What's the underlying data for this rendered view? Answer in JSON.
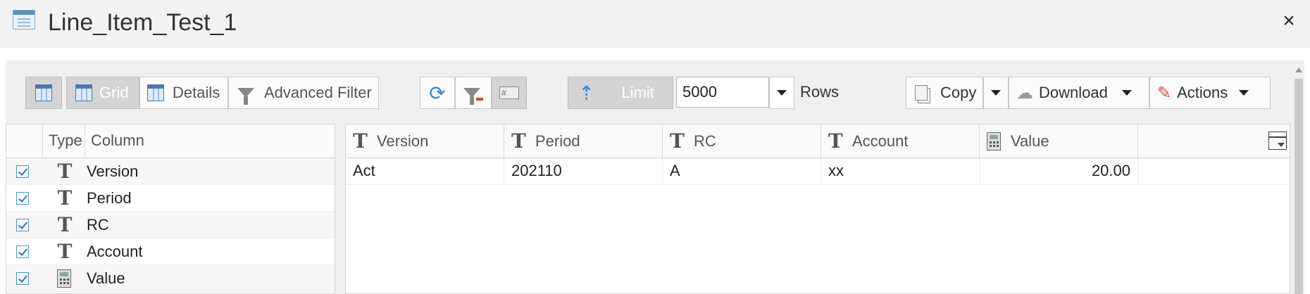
{
  "window": {
    "title": "Line_Item_Test_1",
    "close_label": "×"
  },
  "toolbar": {
    "grid_label": "Grid",
    "details_label": "Details",
    "advanced_filter_label": "Advanced Filter",
    "limit_label": "Limit",
    "limit_value": "5000",
    "rows_label": "Rows",
    "copy_label": "Copy",
    "download_label": "Download",
    "actions_label": "Actions",
    "hash_label": "#"
  },
  "column_list": {
    "headers": {
      "type": "Type",
      "column": "Column"
    },
    "rows": [
      {
        "name": "Version",
        "type": "text",
        "checked": true
      },
      {
        "name": "Period",
        "type": "text",
        "checked": true
      },
      {
        "name": "RC",
        "type": "text",
        "checked": true
      },
      {
        "name": "Account",
        "type": "text",
        "checked": true
      },
      {
        "name": "Value",
        "type": "number",
        "checked": true
      }
    ]
  },
  "grid": {
    "columns": [
      {
        "label": "Version",
        "type": "text"
      },
      {
        "label": "Period",
        "type": "text"
      },
      {
        "label": "RC",
        "type": "text"
      },
      {
        "label": "Account",
        "type": "text"
      },
      {
        "label": "Value",
        "type": "number"
      }
    ],
    "rows": [
      [
        "Act",
        "202110",
        "A",
        "xx",
        "20.00"
      ]
    ]
  },
  "colors": {
    "accent": "#4a78b0",
    "active_button": "#d4d4d4",
    "title_bar": "#f3f3f3"
  }
}
